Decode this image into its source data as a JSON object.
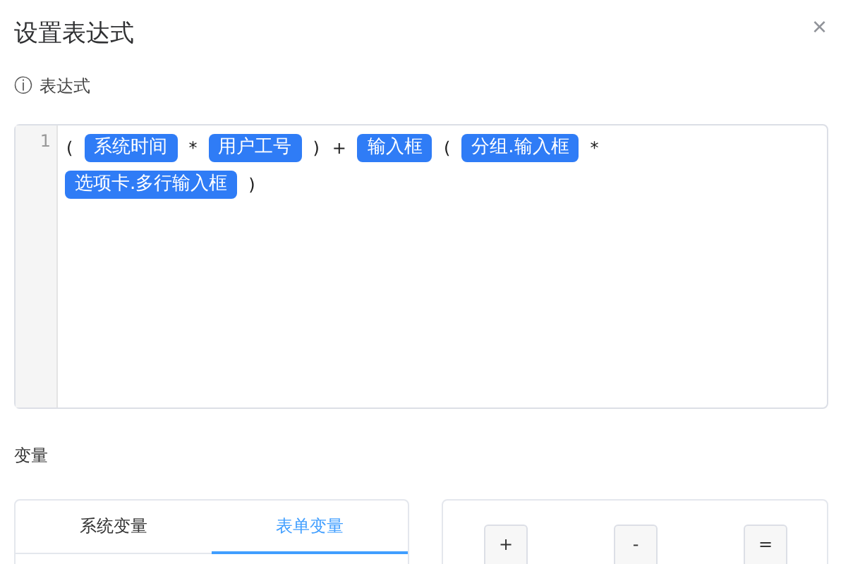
{
  "dialog": {
    "title": "设置表达式",
    "close": "×"
  },
  "expression_label": {
    "icon": "ⓘ",
    "text": "表达式"
  },
  "editor": {
    "line_numbers": [
      "1"
    ],
    "tokens": [
      {
        "kind": "text",
        "text": "("
      },
      {
        "kind": "var",
        "text": "系统时间"
      },
      {
        "kind": "text",
        "text": "*"
      },
      {
        "kind": "var",
        "text": "用户工号"
      },
      {
        "kind": "text",
        "text": ")"
      },
      {
        "kind": "text",
        "text": "+"
      },
      {
        "kind": "var",
        "text": "输入框"
      },
      {
        "kind": "text",
        "text": "("
      },
      {
        "kind": "var",
        "text": "分组.输入框"
      },
      {
        "kind": "text",
        "text": "*"
      },
      {
        "kind": "var",
        "text": "选项卡.多行输入框"
      },
      {
        "kind": "text",
        "text": ")"
      }
    ]
  },
  "variables_label": "变量",
  "tabs": [
    {
      "label": "系统变量",
      "selected": false
    },
    {
      "label": "表单变量",
      "selected": true
    }
  ],
  "operators": [
    "+",
    "-",
    "="
  ]
}
